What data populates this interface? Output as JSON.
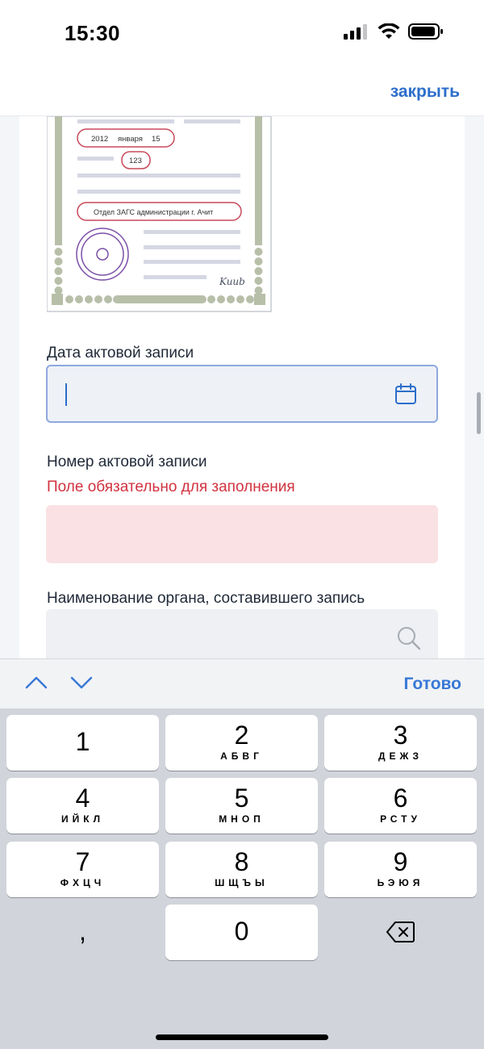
{
  "status_bar": {
    "time": "15:30"
  },
  "header": {
    "close_label": "закрыть"
  },
  "document": {
    "date_year": "2012",
    "date_month": "января",
    "date_day": "15",
    "record_number": "123",
    "issuer": "Отдел ЗАГС администрации г. Ачит",
    "signature": "Kuub"
  },
  "form": {
    "date_field": {
      "label": "Дата актовой записи",
      "value": ""
    },
    "number_field": {
      "label": "Номер актовой записи",
      "error": "Поле обязательно для заполнения",
      "value": ""
    },
    "org_field": {
      "label": "Наименование органа, составившего запись",
      "value": ""
    }
  },
  "keyboard_toolbar": {
    "done_label": "Готово"
  },
  "keyboard": {
    "keys": [
      {
        "digit": "1",
        "letters": ""
      },
      {
        "digit": "2",
        "letters": "АБВГ"
      },
      {
        "digit": "3",
        "letters": "ДЕЖЗ"
      },
      {
        "digit": "4",
        "letters": "ИЙКЛ"
      },
      {
        "digit": "5",
        "letters": "МНОП"
      },
      {
        "digit": "6",
        "letters": "РСТУ"
      },
      {
        "digit": "7",
        "letters": "ФХЦЧ"
      },
      {
        "digit": "8",
        "letters": "ШЩЪЫ"
      },
      {
        "digit": "9",
        "letters": "ЬЭЮЯ"
      },
      {
        "digit": ",",
        "letters": ""
      },
      {
        "digit": "0",
        "letters": ""
      }
    ]
  },
  "colors": {
    "accent": "#2c6ecb",
    "error": "#d1323f",
    "error_bg": "#f9e1e4",
    "document_frame": "#b8bfa9",
    "seal": "#7b4fa8",
    "stamp_outline": "#c8485a"
  }
}
